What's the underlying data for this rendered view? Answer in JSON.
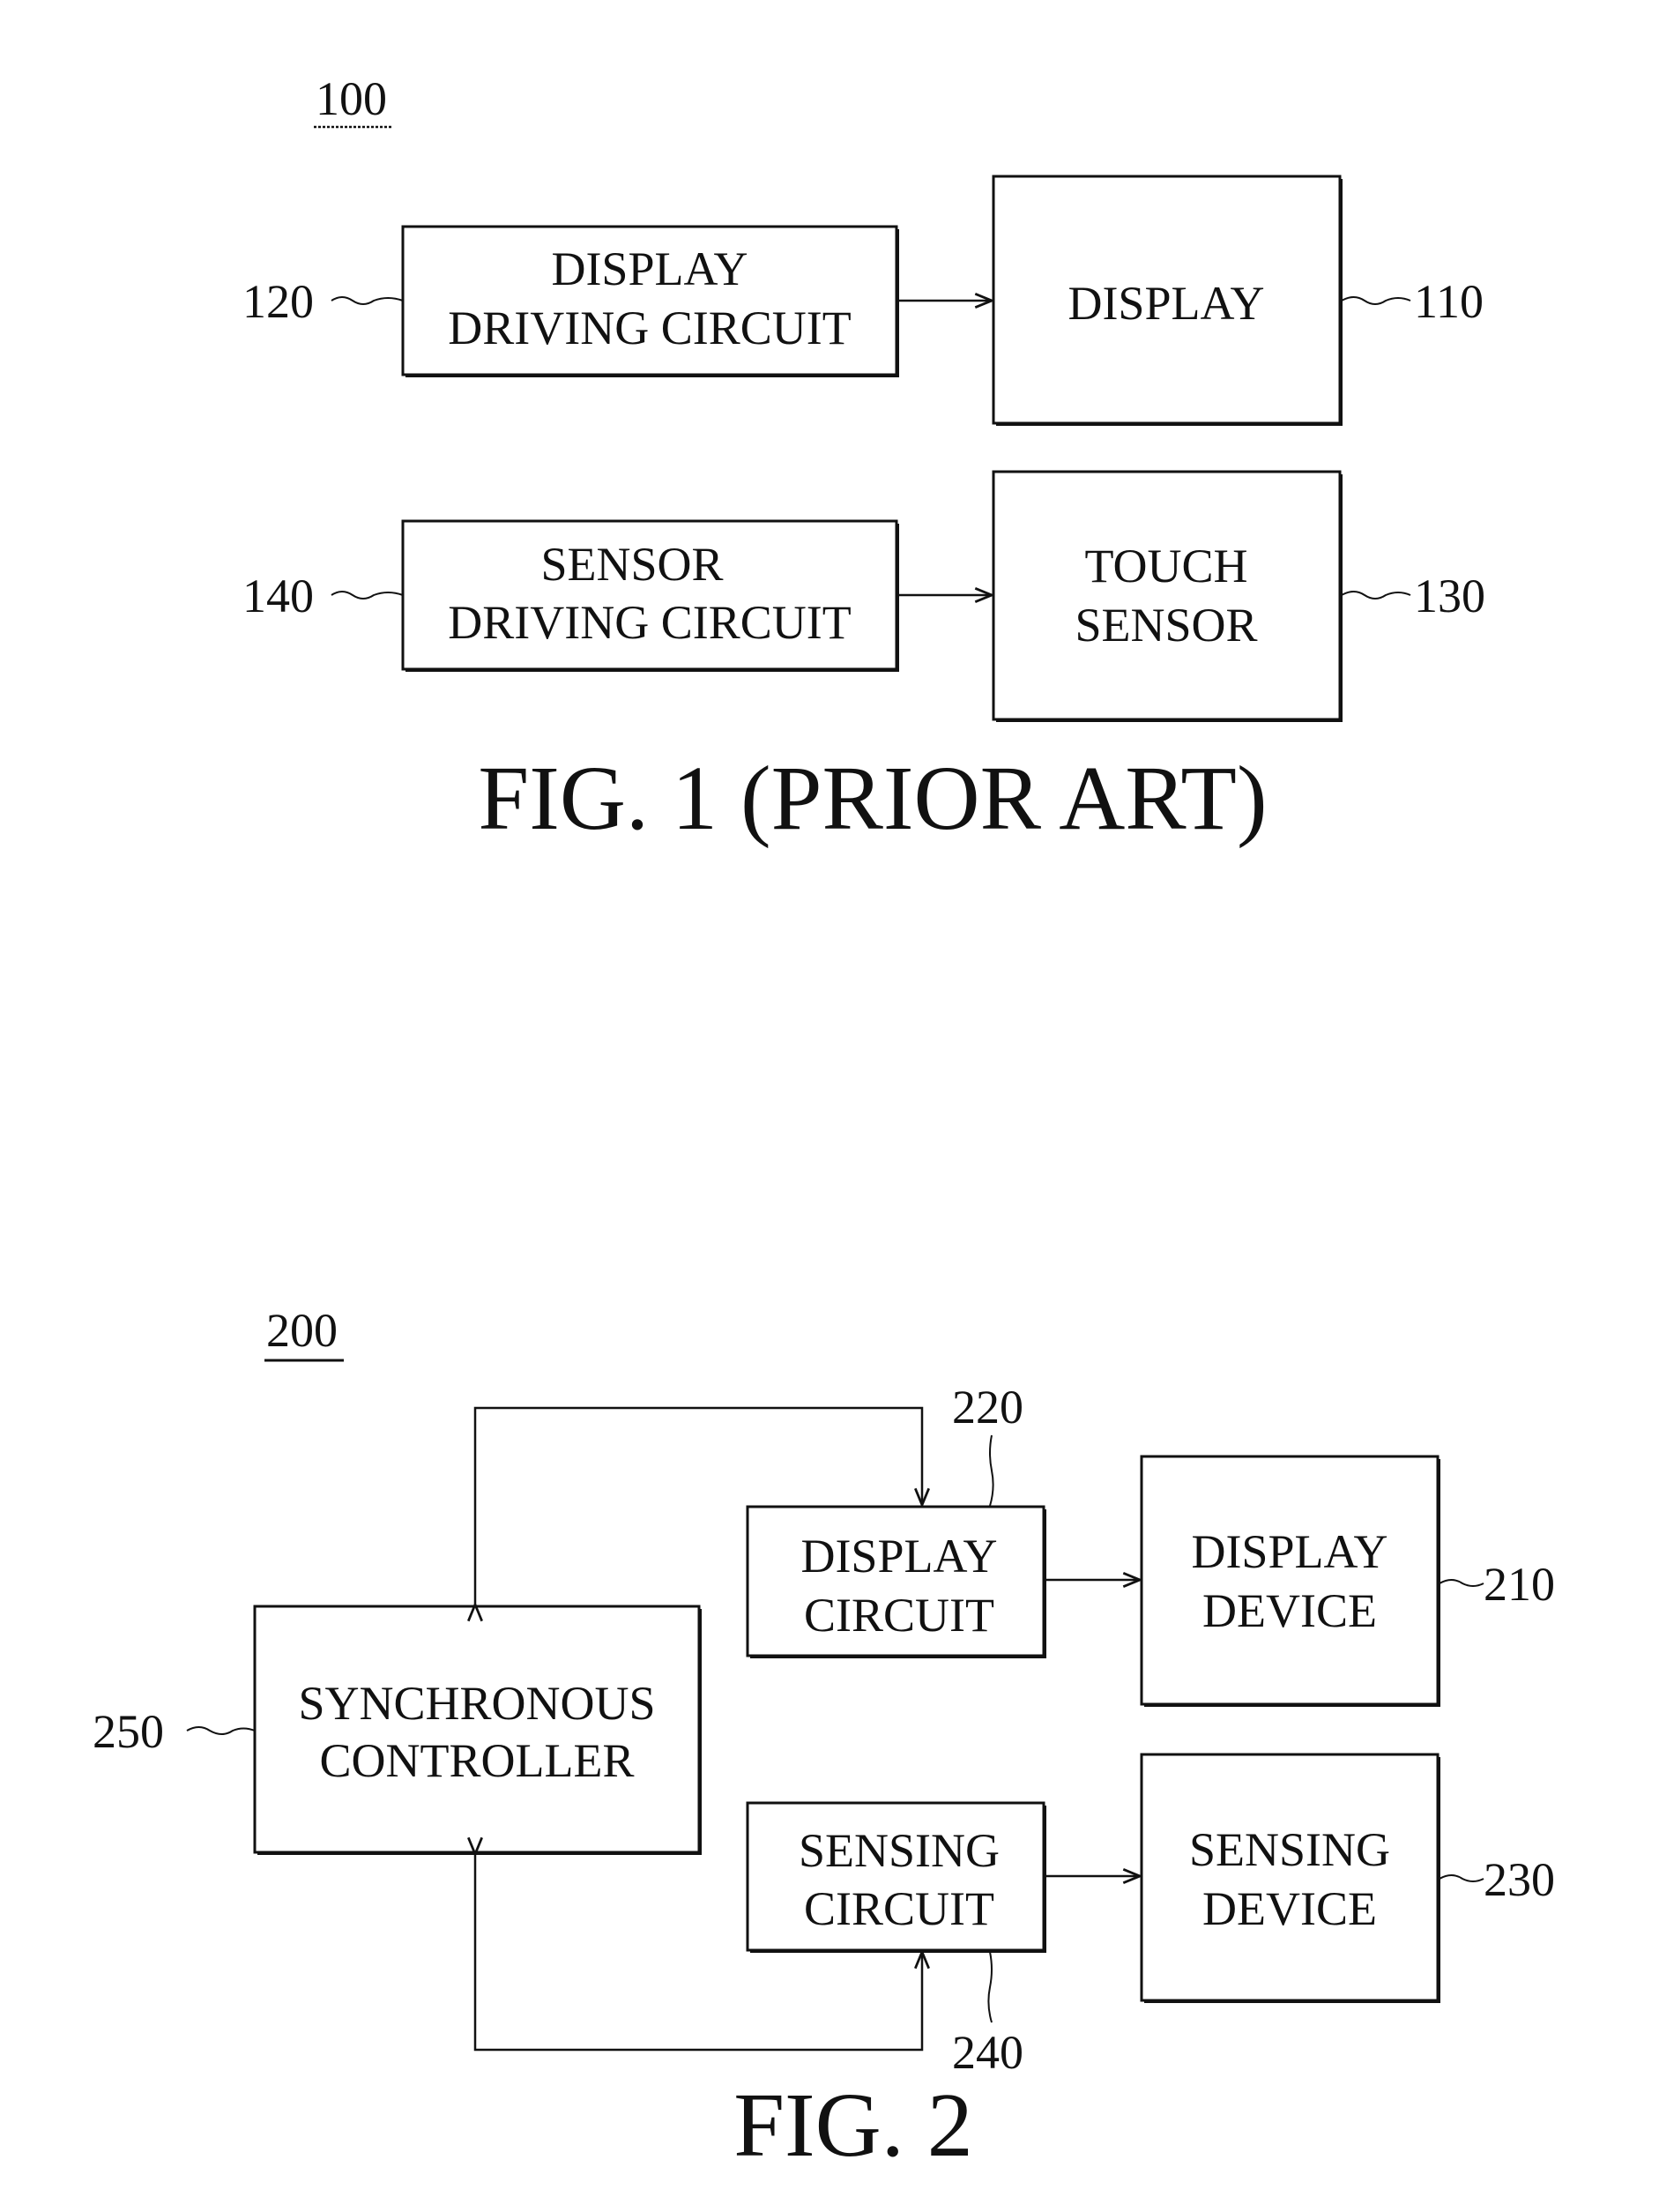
{
  "figure1": {
    "ref_label": "100",
    "caption": "FIG. 1 (PRIOR ART)",
    "blocks": {
      "display_driving_circuit": {
        "ref": "120",
        "lines": [
          "DISPLAY",
          "DRIVING CIRCUIT"
        ]
      },
      "display": {
        "ref": "110",
        "lines": [
          "DISPLAY"
        ]
      },
      "sensor_driving_circuit": {
        "ref": "140",
        "lines": [
          "SENSOR",
          "DRIVING CIRCUIT"
        ]
      },
      "touch_sensor": {
        "ref": "130",
        "lines": [
          "TOUCH",
          "SENSOR"
        ]
      }
    },
    "connections": [
      {
        "from": "display_driving_circuit",
        "to": "display"
      },
      {
        "from": "sensor_driving_circuit",
        "to": "touch_sensor"
      }
    ]
  },
  "figure2": {
    "ref_label": "200",
    "caption": "FIG. 2",
    "blocks": {
      "synchronous_controller": {
        "ref": "250",
        "lines": [
          "SYNCHRONOUS",
          "CONTROLLER"
        ]
      },
      "display_circuit": {
        "ref": "220",
        "lines": [
          "DISPLAY",
          "CIRCUIT"
        ]
      },
      "display_device": {
        "ref": "210",
        "lines": [
          "DISPLAY",
          "DEVICE"
        ]
      },
      "sensing_circuit": {
        "ref": "240",
        "lines": [
          "SENSING",
          "CIRCUIT"
        ]
      },
      "sensing_device": {
        "ref": "230",
        "lines": [
          "SENSING",
          "DEVICE"
        ]
      }
    },
    "connections": [
      {
        "from": "display_circuit",
        "to": "display_device"
      },
      {
        "from": "sensing_circuit",
        "to": "sensing_device"
      },
      {
        "between": [
          "synchronous_controller",
          "display_circuit"
        ],
        "bidirectional": true
      },
      {
        "between": [
          "synchronous_controller",
          "sensing_circuit"
        ],
        "bidirectional": true
      }
    ]
  }
}
